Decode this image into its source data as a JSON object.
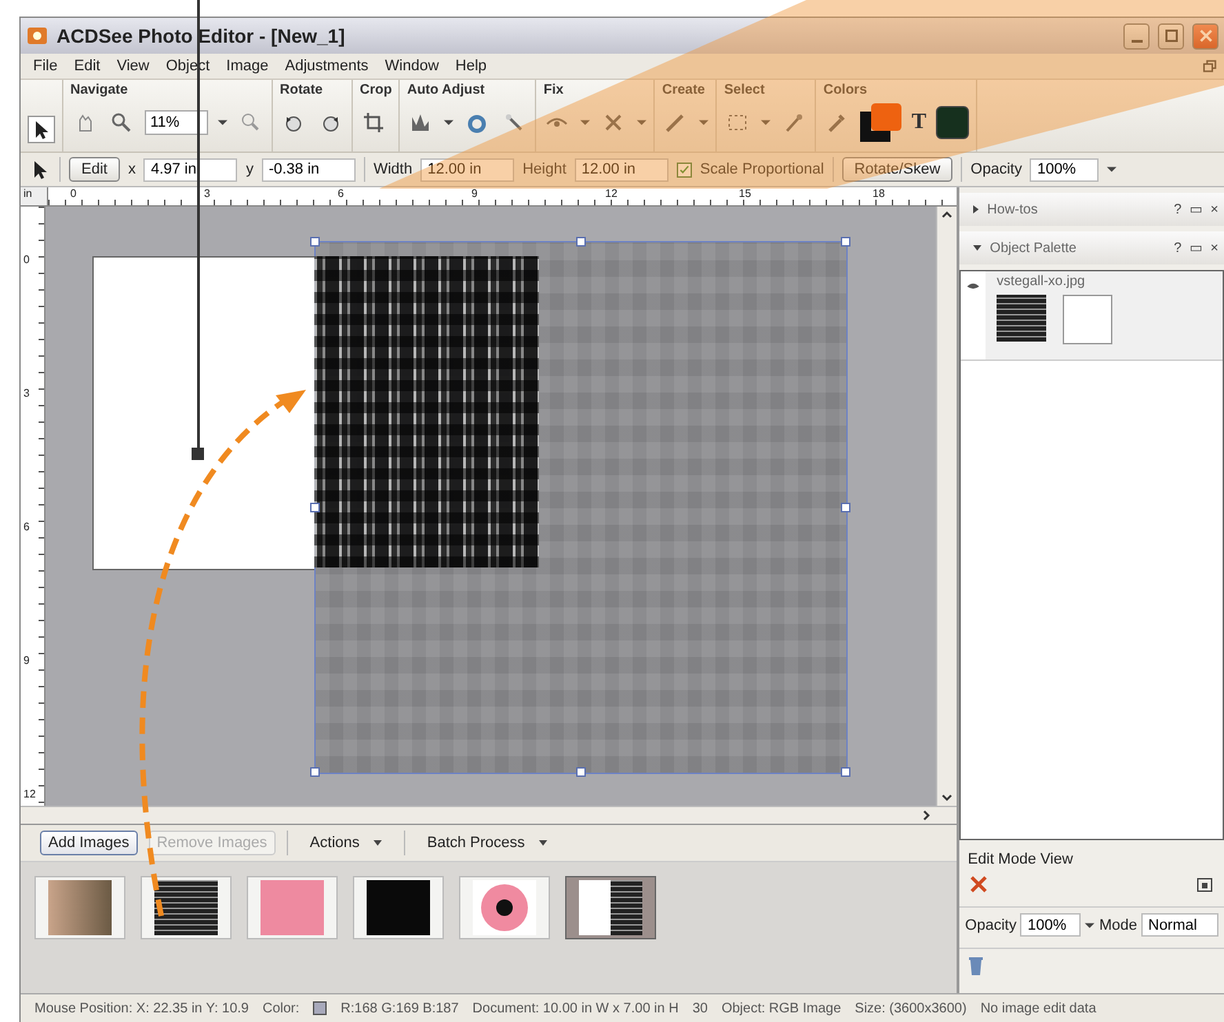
{
  "window": {
    "title": "ACDSee Photo Editor  - [New_1]"
  },
  "menu": [
    "File",
    "Edit",
    "View",
    "Object",
    "Image",
    "Adjustments",
    "Window",
    "Help"
  ],
  "toolbar": {
    "groups": [
      {
        "label": "Navigate",
        "kind": "navigate",
        "zoom": "11%"
      },
      {
        "label": "Rotate",
        "kind": "rotate"
      },
      {
        "label": "Crop",
        "kind": "crop"
      },
      {
        "label": "Auto Adjust",
        "kind": "auto"
      },
      {
        "label": "Fix",
        "kind": "fix"
      },
      {
        "label": "Create",
        "kind": "create"
      },
      {
        "label": "Select",
        "kind": "select"
      },
      {
        "label": "Colors",
        "kind": "colors",
        "swatches": [
          {
            "color": "#ee6210"
          },
          {
            "color": "#111111"
          }
        ],
        "text_color": {
          "label": "T",
          "color": "#16301e"
        }
      }
    ]
  },
  "properties": {
    "edit_button": "Edit",
    "x_label": "x",
    "x": "4.97 in",
    "y_label": "y",
    "y": "-0.38 in",
    "width_label": "Width",
    "width": "12.00 in",
    "height_label": "Height",
    "height": "12.00 in",
    "scale_proportional": {
      "label": "Scale Proportional",
      "checked": true
    },
    "rotate_button": "Rotate/Skew",
    "opacity_label": "Opacity",
    "opacity": "100%"
  },
  "rulers": {
    "horizontal": [
      "0",
      "3",
      "6",
      "9",
      "12",
      "15",
      "18"
    ],
    "vertical": [
      "0",
      "3",
      "6",
      "9",
      "12"
    ],
    "unit": "in"
  },
  "panels": [
    {
      "title": "How-tos",
      "expanded": false,
      "buttons": [
        "?",
        "▭",
        "×"
      ]
    },
    {
      "title": "Object Palette",
      "expanded": true,
      "buttons": [
        "?",
        "▭",
        "×"
      ]
    }
  ],
  "object_palette": {
    "layers": [
      {
        "name": "vstegall-xo.jpg",
        "visible": true
      }
    ],
    "edit_mode_label": "Edit Mode View",
    "opacity_label": "Opacity",
    "opacity": "100%",
    "mode_label": "Mode",
    "mode": "Normal"
  },
  "filmstrip": {
    "buttons": [
      {
        "label": "Add Images",
        "disabled": false
      },
      {
        "label": "Remove Images",
        "disabled": true
      }
    ],
    "menus": [
      "Actions",
      "Batch Process"
    ],
    "thumbnails": [
      {
        "kind": "photo",
        "selected": false
      },
      {
        "kind": "pattern",
        "selected": false
      },
      {
        "kind": "pink",
        "selected": false
      },
      {
        "kind": "black",
        "selected": false
      },
      {
        "kind": "flower",
        "selected": false
      },
      {
        "kind": "composite",
        "selected": true
      }
    ]
  },
  "status_bar": [
    "Mouse Position: X: 22.35 in  Y: 10.9",
    "Color:",
    "R:168  G:169  B:187",
    "Document: 10.00 in W x 7.00 in H",
    "30",
    "Object: RGB Image",
    "Size: (3600x3600)",
    "No image edit data"
  ]
}
